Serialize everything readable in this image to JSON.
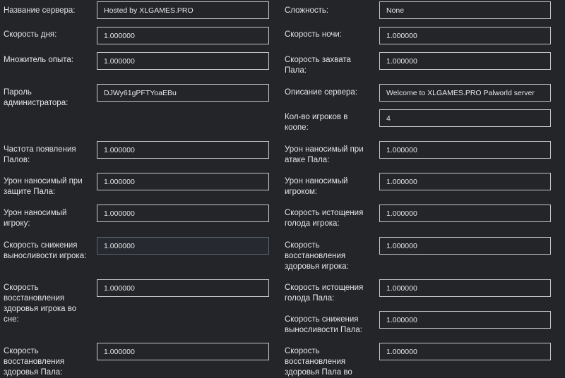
{
  "left": [
    {
      "label": "Название сервера:",
      "value": "Hosted by XLGAMES.PRO"
    },
    {
      "label": "Скорость дня:",
      "value": "1.000000"
    },
    {
      "label": "Множитель опыта:",
      "value": "1.000000"
    },
    {
      "label": "Пароль администратора:",
      "value": "DJWy61gPFTYoaEBu"
    },
    {
      "label": "Частота появления Палов:",
      "value": "1.000000"
    },
    {
      "label": "Урон наносимый при защите Пала:",
      "value": "1.000000"
    },
    {
      "label": "Урон наносимый игроку:",
      "value": "1.000000"
    },
    {
      "label": "Скорость снижения выносливости игрока:",
      "value": "1.000000"
    },
    {
      "label": "Скорость восстановления здоровья игрока во сне:",
      "value": "1.000000"
    },
    {
      "label": "Скорость восстановления здоровья Пала:",
      "value": "1.000000"
    }
  ],
  "right": [
    {
      "label": "Сложность:",
      "value": "None"
    },
    {
      "label": "Скорость ночи:",
      "value": "1.000000"
    },
    {
      "label": "Скорость захвата Пала:",
      "value": "1.000000"
    },
    {
      "label": "Описание сервера:",
      "value": "Welcome to XLGAMES.PRO Palworld server"
    },
    {
      "label": "Кол-во игроков в коопе:",
      "value": "4"
    },
    {
      "label": "Урон наносимый при атаке Пала:",
      "value": "1.000000"
    },
    {
      "label": "Урон наносимый игроком:",
      "value": "1.000000"
    },
    {
      "label": "Скорость истощения голода игрока:",
      "value": "1.000000"
    },
    {
      "label": "Скорость восстановления здоровья игрока:",
      "value": "1.000000"
    },
    {
      "label": "Скорость истощения голода Пала:",
      "value": "1.000000"
    },
    {
      "label": "Скорость снижения выносливости Пала:",
      "value": "1.000000"
    },
    {
      "label": "Скорость восстановления здоровья Пала во сне:",
      "value": "1.000000"
    }
  ]
}
